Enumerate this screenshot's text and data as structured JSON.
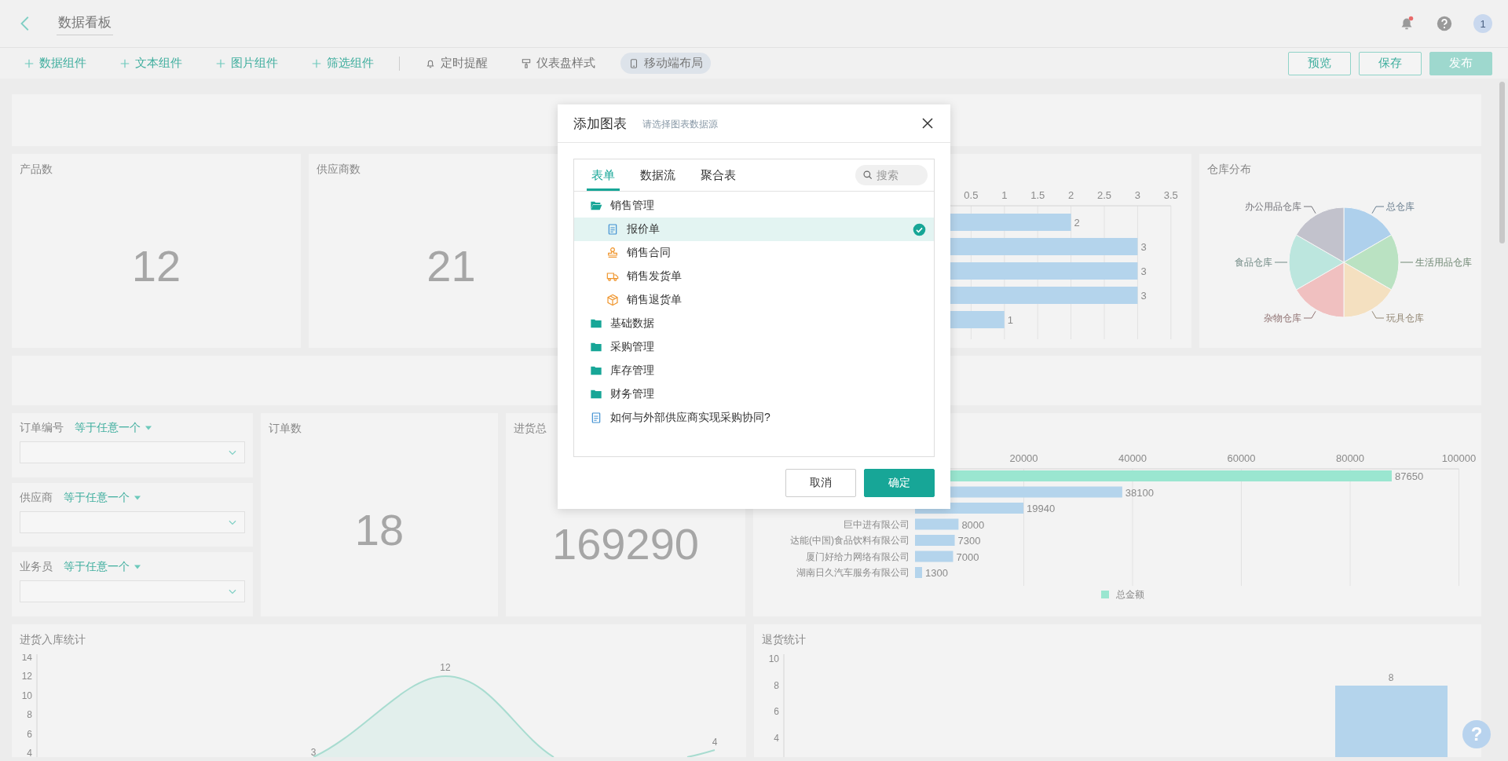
{
  "header": {
    "title": "数据看板",
    "avatar": "1"
  },
  "toolbar": {
    "items": [
      {
        "label": "数据组件",
        "kind": "add",
        "on": false
      },
      {
        "label": "文本组件",
        "kind": "add",
        "on": false
      },
      {
        "label": "图片组件",
        "kind": "add",
        "on": false
      },
      {
        "label": "筛选组件",
        "kind": "add",
        "on": false
      },
      {
        "label": "定时提醒",
        "kind": "reminder",
        "on": false
      },
      {
        "label": "仪表盘样式",
        "kind": "style",
        "on": false
      },
      {
        "label": "移动端布局",
        "kind": "mobile",
        "on": true
      }
    ],
    "buttons": [
      {
        "label": "预览",
        "kind": "outline"
      },
      {
        "label": "保存",
        "kind": "outline"
      },
      {
        "label": "发布",
        "kind": "primary"
      }
    ]
  },
  "stats": [
    {
      "title": "产品数",
      "value": "12"
    },
    {
      "title": "供应商数",
      "value": "21"
    }
  ],
  "top_bar_chart": {
    "chart_data": {
      "type": "bar",
      "orientation": "horizontal",
      "xlim": [
        0,
        3.5
      ],
      "xticks": [
        0.5,
        1,
        1.5,
        2,
        2.5,
        3,
        3.5
      ],
      "grid": true,
      "data_labels": true,
      "categories": [
        null,
        null,
        null,
        null,
        null
      ],
      "series": [
        {
          "color": "#b4d4ec",
          "values": [
            2,
            3,
            3,
            3,
            1
          ]
        }
      ]
    }
  },
  "warehouse_pie": {
    "title": "仓库分布",
    "slices": [
      {
        "label": "总仓库",
        "color": "#aed0ec"
      },
      {
        "label": "生活用品仓库",
        "color": "#bae2c2"
      },
      {
        "label": "玩具仓库",
        "color": "#f4e0c0"
      },
      {
        "label": "杂物仓库",
        "color": "#f0c0c0"
      },
      {
        "label": "食品仓库",
        "color": "#bce6de"
      },
      {
        "label": "办公用品仓库",
        "color": "#c2c2cc"
      }
    ]
  },
  "filters": [
    {
      "label": "订单编号",
      "operator": "等于任意一个"
    },
    {
      "label": "供应商",
      "operator": "等于任意一个"
    },
    {
      "label": "业务员",
      "operator": "等于任意一个"
    }
  ],
  "order_stats": [
    {
      "title": "订单数",
      "value": "18"
    },
    {
      "title": "进货总",
      "value": "169290"
    }
  ],
  "supplier_bar_chart": {
    "chart_data": {
      "type": "bar",
      "orientation": "horizontal",
      "xlim": [
        0,
        100000
      ],
      "xticks": [
        20000,
        40000,
        60000,
        80000,
        100000
      ],
      "grid": true,
      "data_labels": true,
      "categories": [
        null,
        null,
        null,
        "巨中进有限公司",
        "达能(中国)食品饮料有限公司",
        "厦门好给力网络有限公司",
        "湖南日久汽车服务有限公司"
      ],
      "series": [
        {
          "name": "总金额",
          "color": "#9ae6d0",
          "values": [
            87650,
            38100,
            19940,
            8000,
            7300,
            7000,
            1300
          ],
          "colors": [
            "#9ae6d0",
            "#b4d4ec",
            "#b4d4ec",
            "#b4d4ec",
            "#b4d4ec",
            "#b4d4ec",
            "#b4d4ec"
          ]
        }
      ]
    }
  },
  "inbound_chart": {
    "title": "进货入库统计",
    "y_axis_labels": [
      "14",
      "12",
      "10",
      "8",
      "6",
      "4"
    ],
    "point_labels": [
      "3",
      "12",
      "4"
    ]
  },
  "returns_chart": {
    "title": "退货统计",
    "y_axis_labels": [
      "10",
      "8",
      "6",
      "4"
    ],
    "bar_label": "8"
  },
  "help_button": "?",
  "dialog": {
    "title": "添加图表",
    "subtitle": "请选择图表数据源",
    "tabs": [
      {
        "label": "表单",
        "selected": true
      },
      {
        "label": "数据流",
        "selected": false
      },
      {
        "label": "聚合表",
        "selected": false
      }
    ],
    "search": {
      "placeholder": "搜索"
    },
    "tree": [
      {
        "label": "销售管理",
        "kind": "folder",
        "expanded": true,
        "selected": false,
        "children": [
          {
            "label": "报价单",
            "kind": "form",
            "selected": true
          },
          {
            "label": "销售合同",
            "kind": "stamp",
            "selected": false
          },
          {
            "label": "销售发货单",
            "kind": "truck",
            "selected": false
          },
          {
            "label": "销售退货单",
            "kind": "box",
            "selected": false
          }
        ]
      },
      {
        "label": "基础数据",
        "kind": "folder",
        "expanded": false,
        "selected": false
      },
      {
        "label": "采购管理",
        "kind": "folder",
        "expanded": false,
        "selected": false
      },
      {
        "label": "库存管理",
        "kind": "folder",
        "expanded": false,
        "selected": false
      },
      {
        "label": "财务管理",
        "kind": "folder",
        "expanded": false,
        "selected": false
      },
      {
        "label": "如何与外部供应商实现采购协同?",
        "kind": "form",
        "selected": false
      }
    ],
    "buttons": [
      {
        "label": "取消",
        "kind": "cancel"
      },
      {
        "label": "确定",
        "kind": "primary"
      }
    ]
  }
}
